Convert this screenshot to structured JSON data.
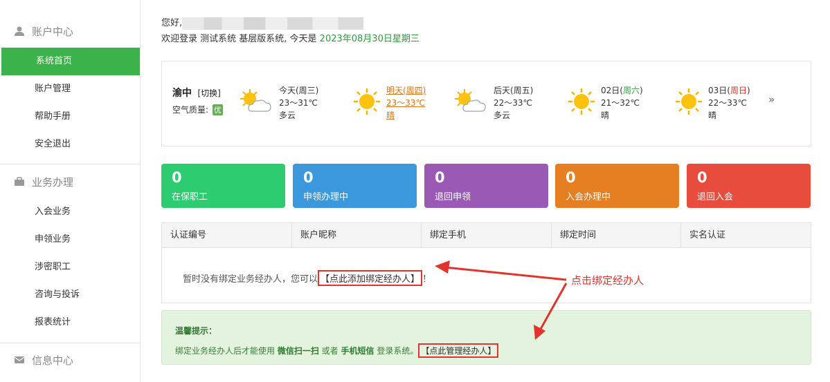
{
  "sidebar": {
    "sections": [
      {
        "title": "账户中心",
        "icon": "user-icon",
        "items": [
          "系统首页",
          "账户管理",
          "帮助手册",
          "安全退出"
        ]
      },
      {
        "title": "业务办理",
        "icon": "briefcase-icon",
        "items": [
          "入会业务",
          "申领业务",
          "涉密职工",
          "咨询与投诉",
          "报表统计"
        ]
      },
      {
        "title": "信息中心",
        "icon": "mail-icon",
        "items": []
      }
    ],
    "active_item": "系统首页"
  },
  "header": {
    "greeting": "您好,",
    "welcome_prefix": "欢迎登录 测试系统 基层版系统,  今天是 ",
    "date": "2023年08月30日星期三"
  },
  "weather": {
    "city": "渝中",
    "switch_label": "[切换]",
    "air_label": "空气质量:",
    "air_value": "优",
    "days": [
      {
        "name": "今天(周三)",
        "temp": "23～31℃",
        "desc": "多云",
        "icon": "partly-cloudy-icon"
      },
      {
        "name": "明天(周四)",
        "temp": "23～33℃",
        "desc": "晴",
        "icon": "sun-icon"
      },
      {
        "name": "后天(周五)",
        "temp": "22～33℃",
        "desc": "多云",
        "icon": "partly-cloudy-icon"
      },
      {
        "name_prefix": "02日(",
        "name_week": "周六",
        "name_suffix": ")",
        "temp": "21～32℃",
        "desc": "晴",
        "icon": "sun-icon"
      },
      {
        "name_prefix": "03日(",
        "name_week": "周日",
        "name_suffix": ")",
        "temp": "22～33℃",
        "desc": "晴",
        "icon": "sun-icon"
      }
    ],
    "more": "»"
  },
  "stats": [
    {
      "value": "0",
      "label": "在保职工",
      "color": "#2ecc71"
    },
    {
      "value": "0",
      "label": "申领办理中",
      "color": "#3b98dc"
    },
    {
      "value": "0",
      "label": "退回申领",
      "color": "#9b59b6"
    },
    {
      "value": "0",
      "label": "入会办理中",
      "color": "#e67e22"
    },
    {
      "value": "0",
      "label": "退回入会",
      "color": "#e74c3c"
    }
  ],
  "table": {
    "columns": [
      "认证编号",
      "账户昵称",
      "绑定手机",
      "绑定时间",
      "实名认证"
    ],
    "empty_text": "暂时没有绑定业务经办人，您可以",
    "add_link": "【点此添加绑定经办人】",
    "empty_suffix": "！"
  },
  "tip": {
    "title": "温馨提示：",
    "text_a": "绑定业务经办人后才能使用 ",
    "bold_a": "微信扫一扫",
    "text_b": " 或者 ",
    "bold_b": "手机短信",
    "text_c": " 登录系统。",
    "manage_link": "【点此管理经办人】"
  },
  "annotation": "点击绑定经办人",
  "colors": {
    "accent": "#3cb34a",
    "annotation": "#e0342c"
  }
}
